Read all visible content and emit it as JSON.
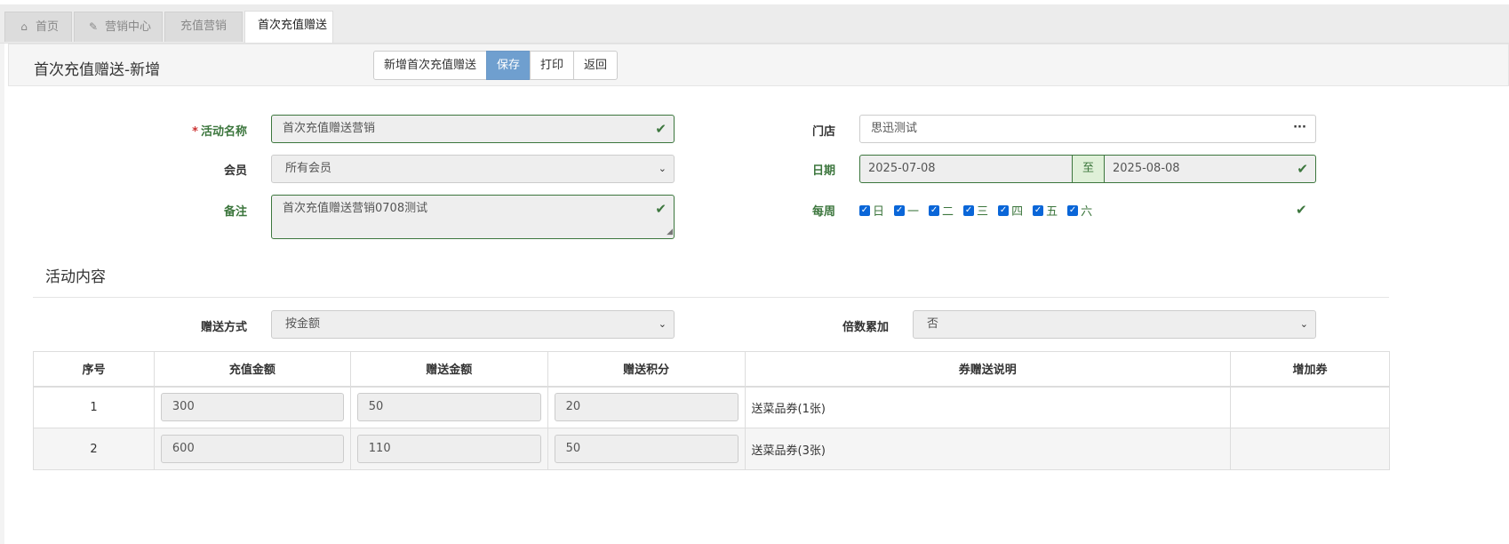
{
  "tabs": [
    {
      "label": "首页",
      "icon": "home-icon"
    },
    {
      "label": "营销中心",
      "icon": "edit-icon"
    },
    {
      "label": "充值营销",
      "icon": ""
    },
    {
      "label": "首次充值赠送",
      "icon": ""
    }
  ],
  "header": {
    "title": "首次充值赠送-新增",
    "buttons": {
      "new": "新增首次充值赠送",
      "save": "保存",
      "print": "打印",
      "back": "返回"
    }
  },
  "form": {
    "activity_name": {
      "required_mark": "*",
      "label": "活动名称",
      "value": "首次充值赠送营销"
    },
    "member": {
      "label": "会员",
      "value": "所有会员"
    },
    "remark": {
      "label": "备注",
      "value": "首次充值赠送营销0708测试"
    },
    "store": {
      "label": "门店",
      "value": "思迅测试",
      "picker": "···"
    },
    "date": {
      "label": "日期",
      "start": "2025-07-08",
      "to": "至",
      "end": "2025-08-08"
    },
    "weekly": {
      "label": "每周",
      "days": [
        "日",
        "一",
        "二",
        "三",
        "四",
        "五",
        "六"
      ]
    }
  },
  "content": {
    "section_title": "活动内容",
    "gift_mode": {
      "label": "赠送方式",
      "value": "按金额"
    },
    "multiple": {
      "label": "倍数累加",
      "value": "否"
    },
    "table": {
      "headers": [
        "序号",
        "充值金额",
        "赠送金额",
        "赠送积分",
        "券赠送说明",
        "增加券"
      ],
      "rows": [
        {
          "no": "1",
          "recharge": "300",
          "gift": "50",
          "points": "20",
          "coupon_desc": "送菜品券(1张)",
          "add_coupon": ""
        },
        {
          "no": "2",
          "recharge": "600",
          "gift": "110",
          "points": "50",
          "coupon_desc": "送菜品券(3张)",
          "add_coupon": ""
        }
      ]
    }
  },
  "colors": {
    "success": "#3c763d",
    "primary": "#6f9fcf"
  }
}
